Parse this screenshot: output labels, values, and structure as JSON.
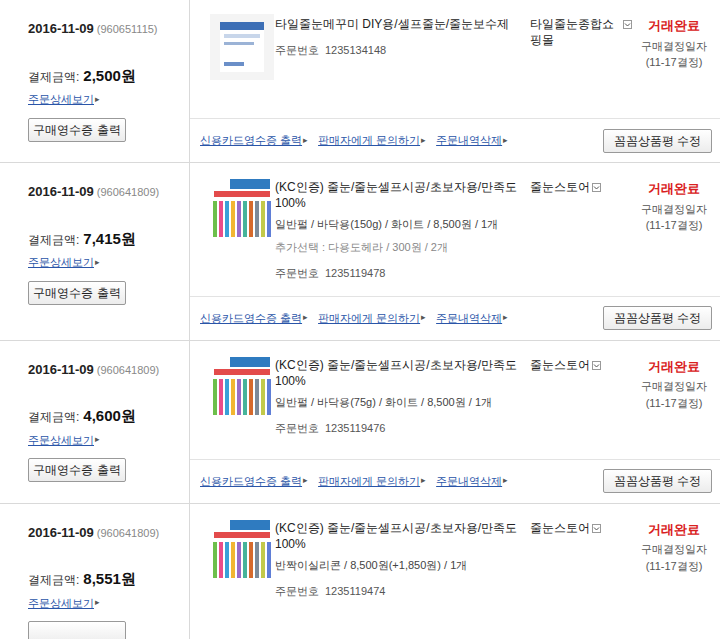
{
  "link_arrow": "▸",
  "orders": [
    {
      "date": "2016-11-09",
      "order_group": "(960651115)",
      "amount_label": "결제금액:",
      "amount": "2,500원",
      "detail_link": "주문상세보기",
      "receipt_button": "구매영수증 출력",
      "product": {
        "name": "타일줄눈메꾸미 DIY용/셀프줄눈/줄눈보수제",
        "options": [],
        "extra": "",
        "order_no_label": "주문번호",
        "order_no": "1235134148",
        "thumb": "tube"
      },
      "seller": "타일줄눈종합쇼핑몰",
      "status": "거래완료",
      "decision_label": "구매결정일자",
      "decision_date": "(11-17결정)",
      "actions": [
        "신용카드영수증 출력",
        "판매자에게 문의하기",
        "주문내역삭제"
      ],
      "review_button": "꼼꼼상품평 수정"
    },
    {
      "date": "2016-11-09",
      "order_group": "(960641809)",
      "amount_label": "결제금액:",
      "amount": "7,415원",
      "detail_link": "주문상세보기",
      "receipt_button": "구매영수증 출력",
      "product": {
        "name": "(KC인증) 줄눈/줄눈셀프시공/초보자용/만족도100%",
        "options": [
          "일반펄 / 바닥용(150g) / 화이트 / 8,500원 / 1개"
        ],
        "extra": "추가선택 : 다용도헤라 / 300원 / 2개",
        "order_no_label": "주문번호",
        "order_no": "1235119478",
        "thumb": "colors"
      },
      "seller": "줄눈스토어",
      "status": "거래완료",
      "decision_label": "구매결정일자",
      "decision_date": "(11-17결정)",
      "actions": [
        "신용카드영수증 출력",
        "판매자에게 문의하기",
        "주문내역삭제"
      ],
      "review_button": "꼼꼼상품평 수정"
    },
    {
      "date": "2016-11-09",
      "order_group": "(960641809)",
      "amount_label": "결제금액:",
      "amount": "4,600원",
      "detail_link": "주문상세보기",
      "receipt_button": "구매영수증 출력",
      "product": {
        "name": "(KC인증) 줄눈/줄눈셀프시공/초보자용/만족도100%",
        "options": [
          "일반펄 / 바닥용(75g) / 화이트 / 8,500원 / 1개"
        ],
        "extra": "",
        "order_no_label": "주문번호",
        "order_no": "1235119476",
        "thumb": "colors"
      },
      "seller": "줄눈스토어",
      "status": "거래완료",
      "decision_label": "구매결정일자",
      "decision_date": "(11-17결정)",
      "actions": [
        "신용카드영수증 출력",
        "판매자에게 문의하기",
        "주문내역삭제"
      ],
      "review_button": "꼼꼼상품평 수정"
    },
    {
      "date": "2016-11-09",
      "order_group": "(960641809)",
      "amount_label": "결제금액:",
      "amount": "8,551원",
      "detail_link": "주문상세보기",
      "product": {
        "name": "(KC인증) 줄눈/줄눈셀프시공/초보자용/만족도100%",
        "options": [
          "반짝이실리콘 / 8,500원(+1,850원) / 1개"
        ],
        "extra": "",
        "order_no_label": "주문번호",
        "order_no": "1235119474",
        "thumb": "colors"
      },
      "seller": "줄눈스토어",
      "status": "거래완료",
      "decision_label": "구매결정일자",
      "decision_date": "(11-17결정)",
      "actions": [],
      "review_button": ""
    }
  ]
}
